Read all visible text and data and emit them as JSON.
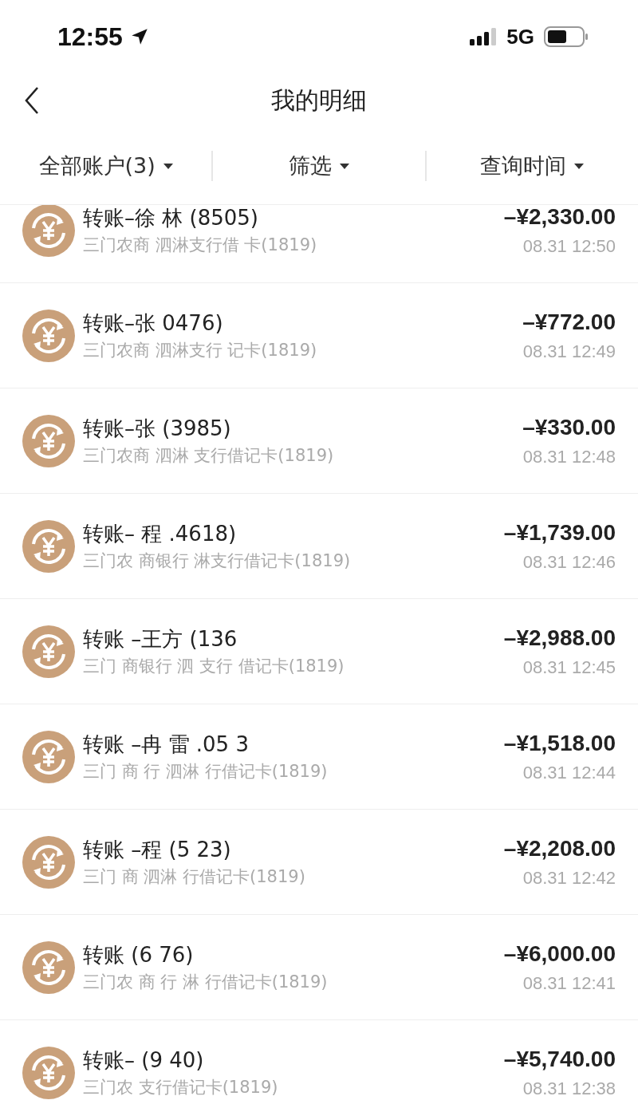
{
  "status_bar": {
    "time": "12:55",
    "network": "5G"
  },
  "nav": {
    "title": "我的明细"
  },
  "filters": [
    {
      "label": "全部账户(3)"
    },
    {
      "label": "筛选"
    },
    {
      "label": "查询时间"
    }
  ],
  "transactions": [
    {
      "title": "转账–徐 林 (8505)",
      "account": "三门农商 泗淋支行借 卡(1819)",
      "amount": "–¥2,330.00",
      "time": "08.31 12:50"
    },
    {
      "title": "转账–张 0476)",
      "account": "三门农商 泗淋支行 记卡(1819)",
      "amount": "–¥772.00",
      "time": "08.31 12:49"
    },
    {
      "title": "转账–张 (3985)",
      "account": "三门农商 泗淋 支行借记卡(1819)",
      "amount": "–¥330.00",
      "time": "08.31 12:48"
    },
    {
      "title": "转账– 程 .4618)",
      "account": "三门农 商银行 淋支行借记卡(1819)",
      "amount": "–¥1,739.00",
      "time": "08.31 12:46"
    },
    {
      "title": "转账 –王方 (136",
      "account": "三门 商银行 泗 支行 借记卡(1819)",
      "amount": "–¥2,988.00",
      "time": "08.31 12:45"
    },
    {
      "title": "转账 –冉 雷 .05 3",
      "account": "三门 商 行 泗淋 行借记卡(1819)",
      "amount": "–¥1,518.00",
      "time": "08.31 12:44"
    },
    {
      "title": "转账 –程 (5 23)",
      "account": "三门 商 泗淋 行借记卡(1819)",
      "amount": "–¥2,208.00",
      "time": "08.31 12:42"
    },
    {
      "title": "转账 (6 76)",
      "account": "三门农 商 行 淋 行借记卡(1819)",
      "amount": "–¥6,000.00",
      "time": "08.31 12:41"
    },
    {
      "title": "转账– (9 40)",
      "account": "三门农 支行借记卡(1819)",
      "amount": "–¥5,740.00",
      "time": "08.31 12:38"
    }
  ]
}
